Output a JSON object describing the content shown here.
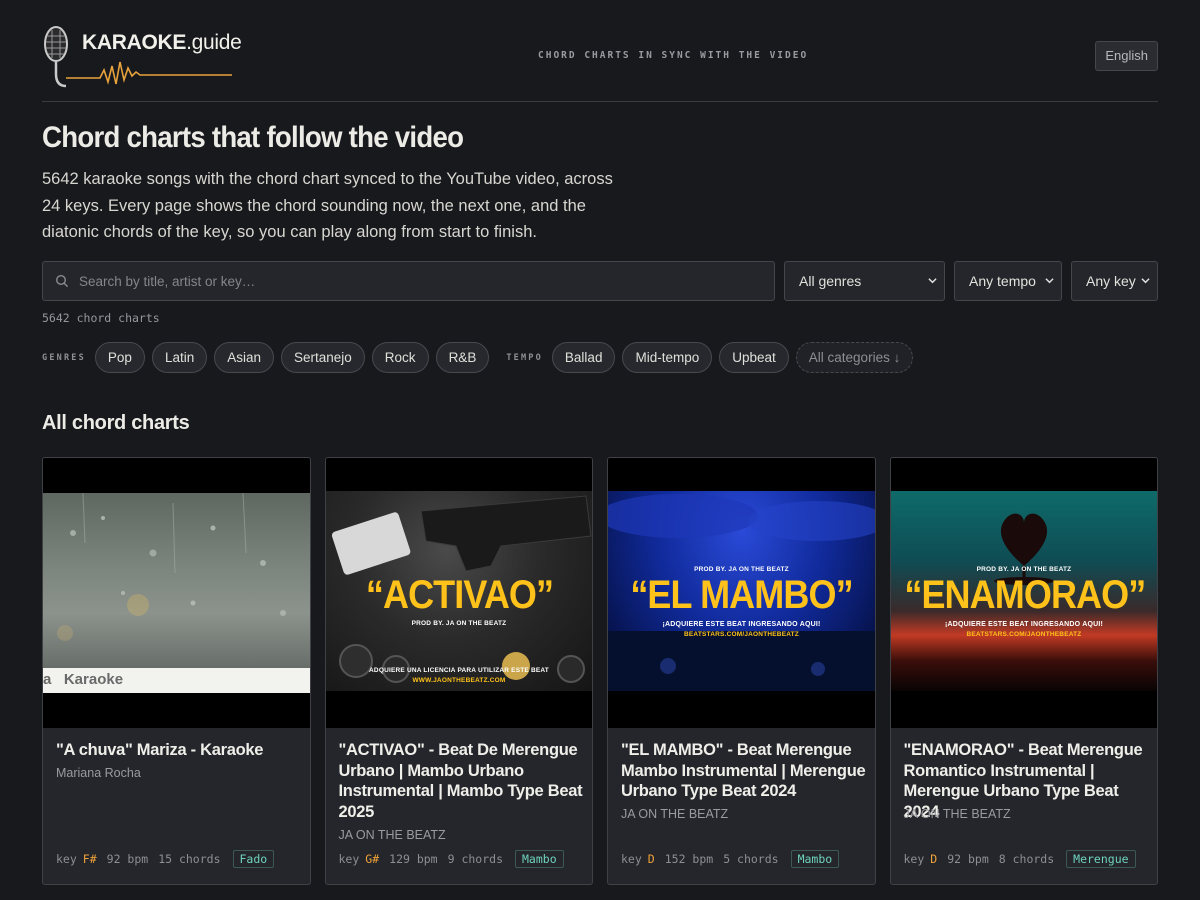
{
  "header": {
    "logo_bold": "KARAOKE",
    "logo_light": ".guide",
    "tagline": "CHORD CHARTS IN SYNC WITH THE VIDEO",
    "language": "English"
  },
  "hero": {
    "title": "Chord charts that follow the video",
    "description": "5642 karaoke songs with the chord chart synced to the YouTube video, across 24 keys. Every page shows the chord sounding now, the next one, and the diatonic chords of the key, so you can play along from start to finish."
  },
  "search": {
    "placeholder": "Search by title, artist or key…",
    "genre_select": "All genres",
    "tempo_select": "Any tempo",
    "key_select": "Any key"
  },
  "count_text": "5642 chord charts",
  "filters": {
    "genres_label": "GENRES",
    "genres": [
      "Pop",
      "Latin",
      "Asian",
      "Sertanejo",
      "Rock",
      "R&B"
    ],
    "tempo_label": "TEMPO",
    "tempos": [
      "Ballad",
      "Mid-tempo",
      "Upbeat"
    ],
    "all_categories": "All categories ↓"
  },
  "section_title": "All chord charts",
  "cards": [
    {
      "title": "\"A chuva\" Mariza - Karaoke",
      "artist": "Mariana Rocha",
      "key_label": "key",
      "key": "F#",
      "bpm": "92 bpm",
      "chords": "15 chords",
      "genre": "Fado",
      "thumb_caption": "a   Karaoke"
    },
    {
      "title": "\"ACTIVAO\" - Beat De Merengue Urbano | Mambo Urbano Instrumental | Mambo Type Beat 2025",
      "artist": "JA ON THE BEATZ",
      "key_label": "key",
      "key": "G#",
      "bpm": "129 bpm",
      "chords": "9 chords",
      "genre": "Mambo",
      "thumb_word": "“ACTIVAO”",
      "thumb_prod": "PROD BY. JA ON THE BEATZ",
      "thumb_line1": "ADQUIERE UNA LICENCIA PARA UTILIZAR ESTE BEAT",
      "thumb_line2": "WWW.JAONTHEBEATZ.COM"
    },
    {
      "title": "\"EL MAMBO\" - Beat Merengue Mambo Instrumental | Merengue Urbano Type Beat 2024",
      "artist": "JA ON THE BEATZ",
      "key_label": "key",
      "key": "D",
      "bpm": "152 bpm",
      "chords": "5 chords",
      "genre": "Mambo",
      "thumb_word": "“EL MAMBO”",
      "thumb_prod": "PROD BY. JA ON THE BEATZ",
      "thumb_line1": "¡ADQUIERE ESTE BEAT INGRESANDO AQUI!",
      "thumb_line2": "BEATSTARS.COM/JAONTHEBEATZ"
    },
    {
      "title": "\"ENAMORAO\" - Beat Merengue Romantico Instrumental | Merengue Urbano Type Beat 2024",
      "artist": "JA ON THE BEATZ",
      "key_label": "key",
      "key": "D",
      "bpm": "92 bpm",
      "chords": "8 chords",
      "genre": "Merengue",
      "thumb_word": "“ENAMORAO”",
      "thumb_prod": "PROD BY. JA ON THE BEATZ",
      "thumb_line1": "¡ADQUIERE ESTE BEAT INGRESANDO AQUI!",
      "thumb_line2": "BEATSTARS.COM/JAONTHEBEATZ"
    }
  ]
}
